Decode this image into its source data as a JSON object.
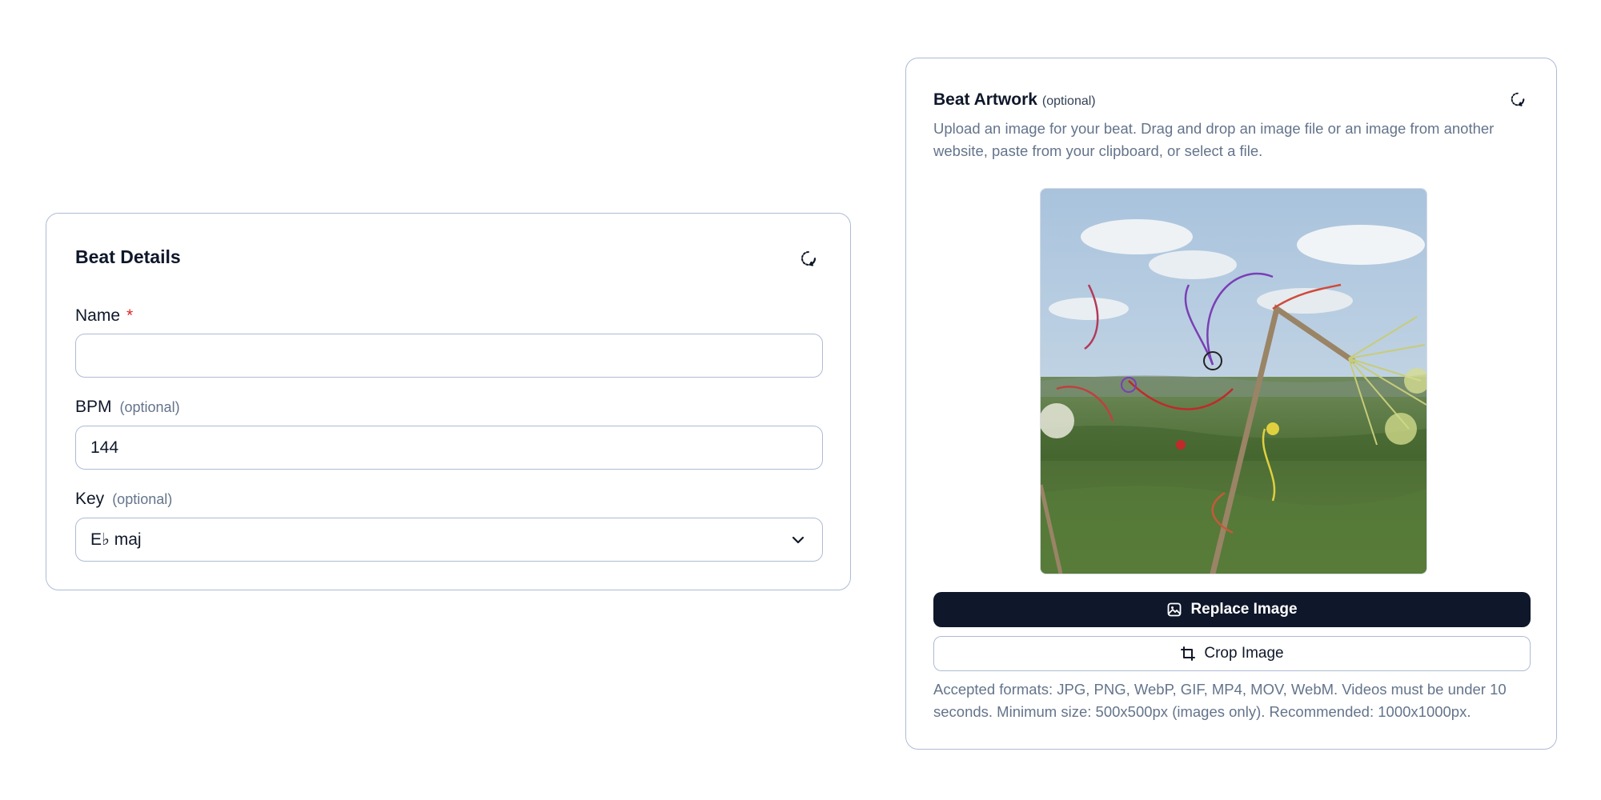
{
  "details": {
    "title": "Beat Details",
    "name_label": "Name",
    "name_required_marker": "*",
    "name_value": "",
    "bpm_label": "BPM",
    "bpm_optional": "(optional)",
    "bpm_value": "144",
    "key_label": "Key",
    "key_optional": "(optional)",
    "key_value": "E♭ maj"
  },
  "artwork": {
    "title": "Beat Artwork",
    "optional": "(optional)",
    "description": "Upload an image for your beat. Drag and drop an image file or an image from another website, paste from your clipboard, or select a file.",
    "replace_label": "Replace Image",
    "crop_label": "Crop Image",
    "footer": "Accepted formats: JPG, PNG, WebP, GIF, MP4, MOV, WebM. Videos must be under 10 seconds. Minimum size: 500x500px (images only). Recommended: 1000x1000px."
  },
  "icons": {
    "reset": "refresh-icon",
    "chevron": "chevron-down-icon",
    "image": "image-icon",
    "crop": "crop-icon"
  },
  "colors": {
    "border": "#aebbd4",
    "primary": "#0f172a",
    "muted": "#64748b",
    "required": "#dc2626"
  }
}
